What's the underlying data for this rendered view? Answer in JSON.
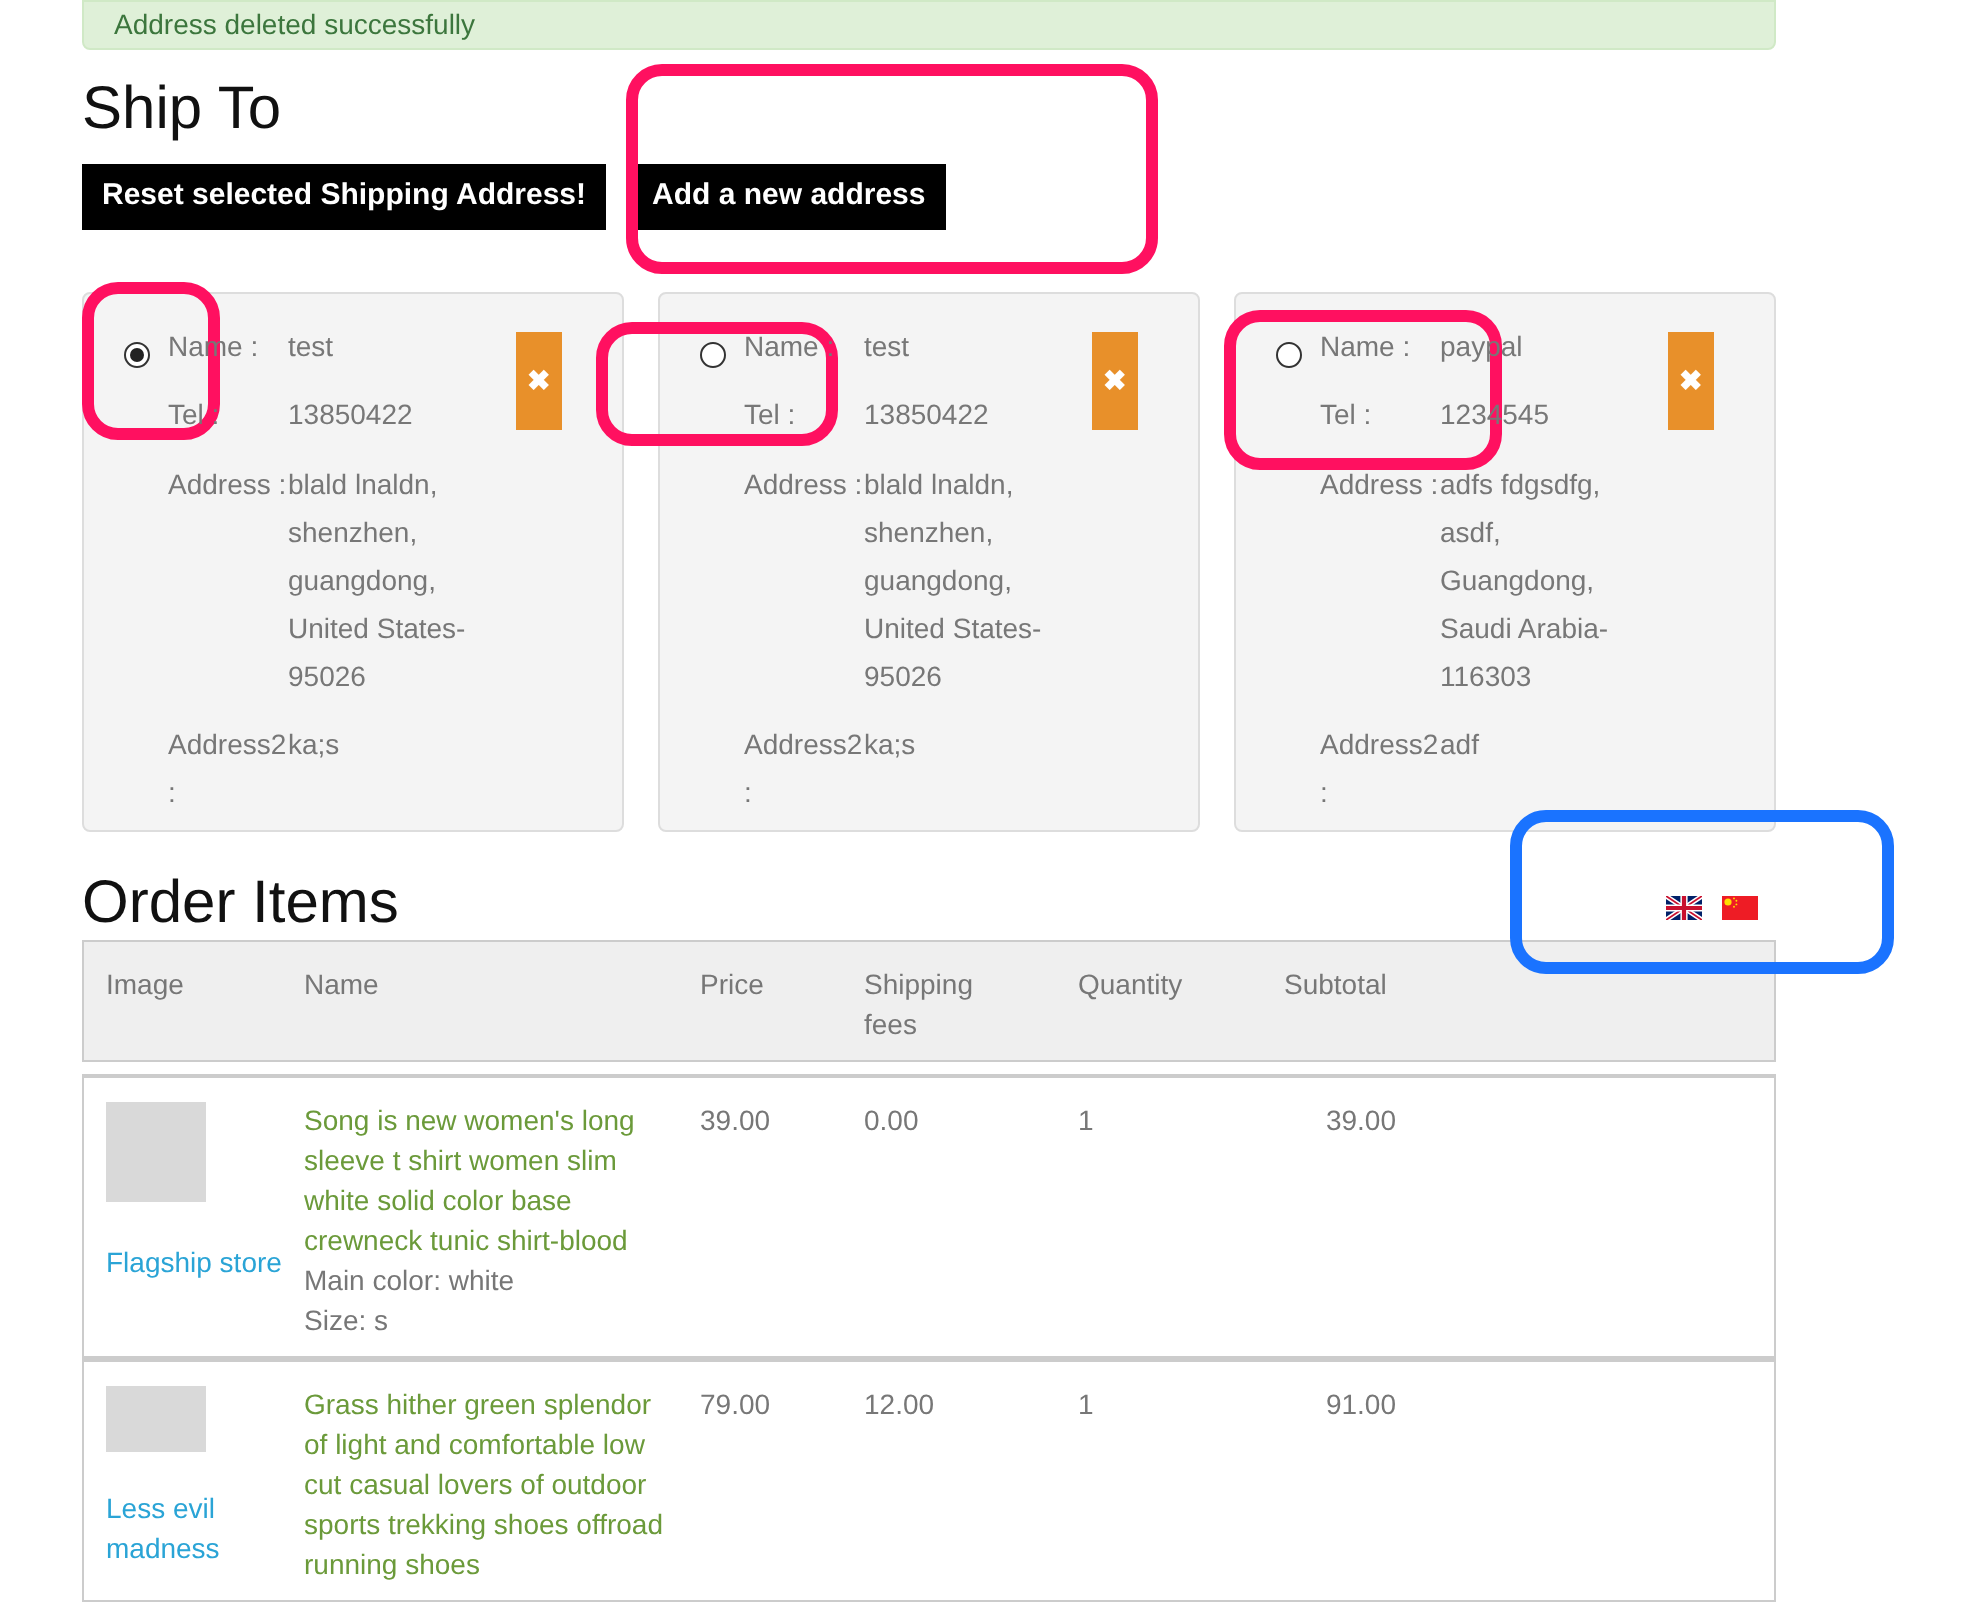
{
  "alert": {
    "text": "Address deleted successfully"
  },
  "ship_to": {
    "title": "Ship To",
    "buttons": [
      "Reset selected Shipping Address!",
      "Add a new address"
    ],
    "addresses": [
      {
        "selected": true,
        "delete_label": "✖",
        "fields": [
          {
            "label": "Name :",
            "value": "test"
          },
          {
            "label": "Tel :",
            "value": "13850422"
          },
          {
            "label": "Address :",
            "value": "blald lnaldn, shenzhen, guangdong, United States-95026"
          },
          {
            "label": "Address2 :",
            "value": "ka;s"
          }
        ]
      },
      {
        "selected": false,
        "delete_label": "✖",
        "fields": [
          {
            "label": "Name :",
            "value": "test"
          },
          {
            "label": "Tel :",
            "value": "13850422"
          },
          {
            "label": "Address :",
            "value": "blald lnaldn, shenzhen, guangdong, United States-95026"
          },
          {
            "label": "Address2 :",
            "value": "ka;s"
          }
        ]
      },
      {
        "selected": false,
        "delete_label": "✖",
        "fields": [
          {
            "label": "Name :",
            "value": "paypal"
          },
          {
            "label": "Tel :",
            "value": "1234545"
          },
          {
            "label": "Address :",
            "value": "adfs fdgsdfg, asdf, Guangdong, Saudi Arabia-116303"
          },
          {
            "label": "Address2 :",
            "value": "adf"
          }
        ]
      }
    ]
  },
  "order_items": {
    "title": "Order Items",
    "columns": [
      "Image",
      "Name",
      "Price",
      "Shipping fees",
      "Quantity",
      "Subtotal"
    ],
    "rows": [
      {
        "store": "Flagship store",
        "name": "Song is new women's long sleeve t shirt women slim white solid color base crewneck tunic shirt-blood",
        "details": [
          "Main color: white",
          "Size: s"
        ],
        "price": "39.00",
        "shipping": "0.00",
        "quantity": "1",
        "subtotal": "39.00"
      },
      {
        "store": "Less evil madness",
        "name": "Grass hither green splendor of light and comfortable low cut casual lovers of outdoor sports trekking shoes offroad running shoes",
        "details": [],
        "price": "79.00",
        "shipping": "12.00",
        "quantity": "1",
        "subtotal": "91.00"
      }
    ]
  },
  "annotations": [
    {
      "color": "#ff1060"
    },
    {
      "color": "#ff1060"
    },
    {
      "color": "#ff1060"
    },
    {
      "color": "#ff1060"
    },
    {
      "color": "#1a73ff"
    }
  ]
}
